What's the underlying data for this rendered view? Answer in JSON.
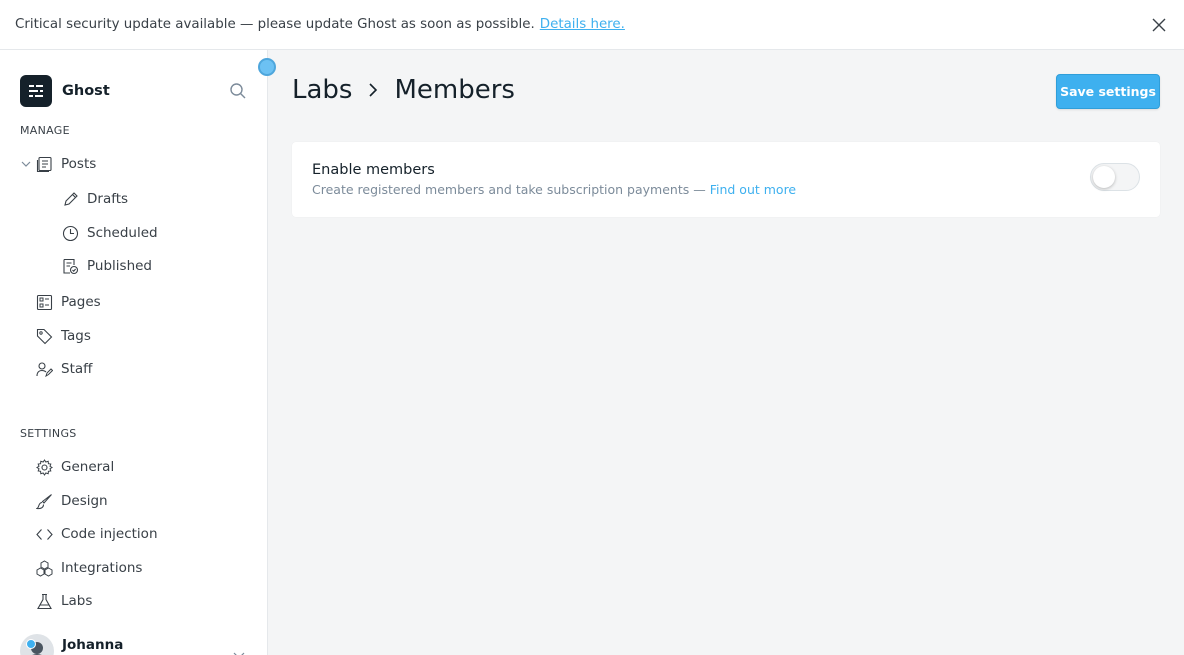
{
  "banner": {
    "message": "Critical security update available — please update Ghost as soon as possible.",
    "link": "Details here.",
    "close_icon": "close-icon"
  },
  "sidebar": {
    "brand": "Ghost",
    "search_icon": "search-icon",
    "manage_label": "MANAGE",
    "manage_items": [
      {
        "label": "Posts",
        "icon": "posts-icon"
      },
      {
        "label": "Drafts",
        "icon": "pencil-icon"
      },
      {
        "label": "Scheduled",
        "icon": "clock-icon"
      },
      {
        "label": "Published",
        "icon": "published-icon"
      },
      {
        "label": "Pages",
        "icon": "pages-icon"
      },
      {
        "label": "Tags",
        "icon": "tag-icon"
      },
      {
        "label": "Staff",
        "icon": "staff-icon"
      }
    ],
    "settings_label": "SETTINGS",
    "settings_items": [
      {
        "label": "General",
        "icon": "gear-icon"
      },
      {
        "label": "Design",
        "icon": "brush-icon"
      },
      {
        "label": "Code injection",
        "icon": "code-icon"
      },
      {
        "label": "Integrations",
        "icon": "integrations-icon"
      },
      {
        "label": "Labs",
        "icon": "flask-icon"
      }
    ],
    "user": {
      "name": "Johanna"
    }
  },
  "main": {
    "breadcrumb": [
      "Labs",
      "Members"
    ],
    "save_button": "Save settings",
    "setting": {
      "title": "Enable members",
      "description": "Create registered members and take subscription payments —",
      "link": "Find out more",
      "enabled": false
    }
  },
  "colors": {
    "accent": "#3eb0ef",
    "text": "#15212a",
    "muted": "#7c8b9a",
    "background": "#f4f5f6"
  }
}
